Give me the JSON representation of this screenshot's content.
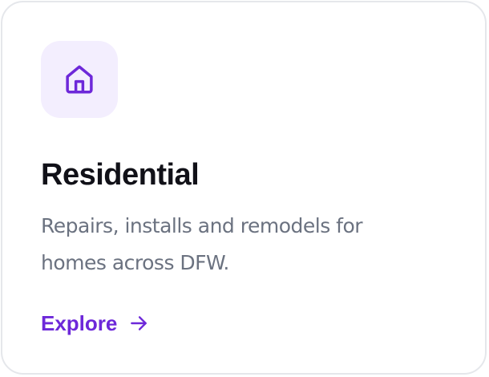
{
  "card": {
    "icon": "home-icon",
    "title": "Residential",
    "description": "Repairs, installs and remodels for homes across DFW.",
    "link_label": "Explore",
    "link_icon": "arrow-right-icon"
  },
  "colors": {
    "accent": "#6d28d9",
    "icon_tile_bg": "#f3eefe",
    "title": "#111118",
    "body_text": "#6b7280",
    "border": "#e5e7eb"
  }
}
